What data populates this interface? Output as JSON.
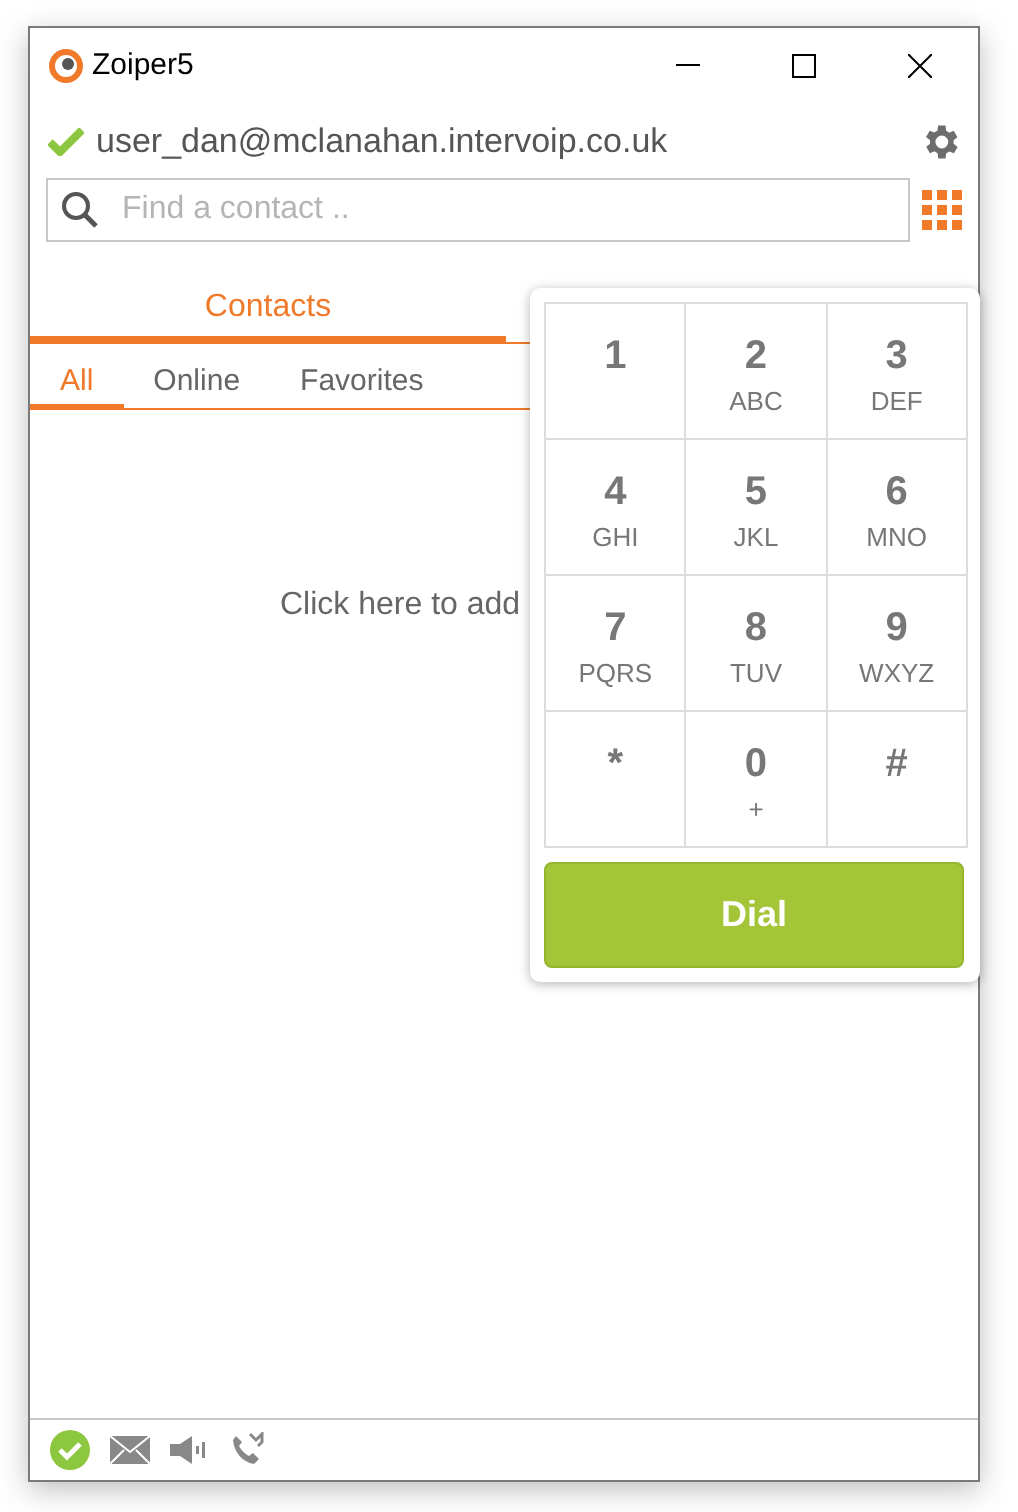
{
  "window": {
    "title": "Zoiper5"
  },
  "account": {
    "name": "user_dan@mclanahan.intervoip.co.uk",
    "registered": true
  },
  "search": {
    "placeholder": "Find a contact .."
  },
  "tabs": [
    {
      "label": "Contacts",
      "selected": true
    }
  ],
  "filters": [
    {
      "label": "All",
      "selected": true
    },
    {
      "label": "Online",
      "selected": false
    },
    {
      "label": "Favorites",
      "selected": false
    }
  ],
  "empty_hint": "Click here to add",
  "dialpad": {
    "keys": [
      {
        "digit": "1"
      },
      {
        "digit": "2",
        "letters": "ABC"
      },
      {
        "digit": "3",
        "letters": "DEF"
      },
      {
        "digit": "4",
        "letters": "GHI"
      },
      {
        "digit": "5",
        "letters": "JKL"
      },
      {
        "digit": "6",
        "letters": "MNO"
      },
      {
        "digit": "7",
        "letters": "PQRS"
      },
      {
        "digit": "8",
        "letters": "TUV"
      },
      {
        "digit": "9",
        "letters": "WXYZ"
      },
      {
        "digit": "*"
      },
      {
        "digit": "0",
        "letters": "+"
      },
      {
        "digit": "#"
      }
    ],
    "dial_button": "Dial"
  }
}
